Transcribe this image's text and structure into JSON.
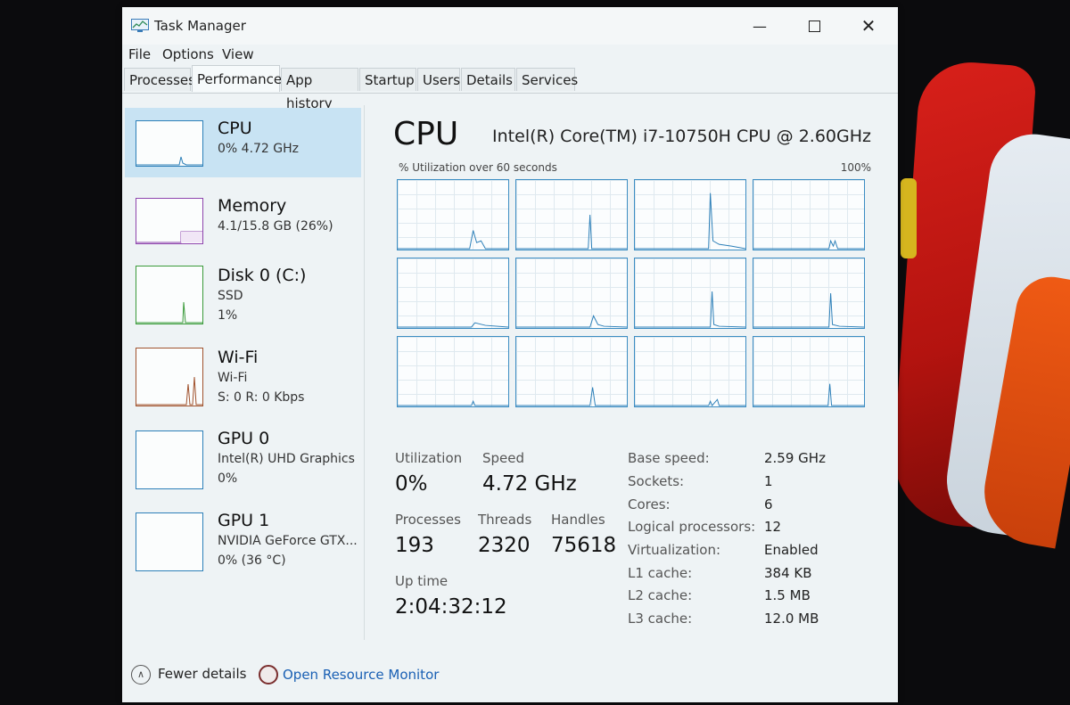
{
  "window": {
    "title": "Task Manager"
  },
  "menu": [
    "File",
    "Options",
    "View"
  ],
  "tabs": [
    {
      "label": "Processes"
    },
    {
      "label": "Performance"
    },
    {
      "label": "App history"
    },
    {
      "label": "Startup"
    },
    {
      "label": "Users"
    },
    {
      "label": "Details"
    },
    {
      "label": "Services"
    }
  ],
  "active_tab": "Performance",
  "sidebar": {
    "items": [
      {
        "name": "CPU",
        "line1": "0% 4.72 GHz",
        "line2": "",
        "color": "#2c7fb8"
      },
      {
        "name": "Memory",
        "line1": "4.1/15.8 GB (26%)",
        "line2": "",
        "color": "#8e44ad"
      },
      {
        "name": "Disk 0 (C:)",
        "line1": "SSD",
        "line2": "1%",
        "color": "#3a9a3a"
      },
      {
        "name": "Wi-Fi",
        "line1": "Wi-Fi",
        "line2": "S: 0 R: 0 Kbps",
        "color": "#a0522d"
      },
      {
        "name": "GPU 0",
        "line1": "Intel(R) UHD Graphics",
        "line2": "0%",
        "color": "#2c7fb8"
      },
      {
        "name": "GPU 1",
        "line1": "NVIDIA GeForce GTX...",
        "line2": "0% (36 °C)",
        "color": "#2c7fb8"
      }
    ]
  },
  "cpu": {
    "title": "CPU",
    "model": "Intel(R) Core(TM) i7-10750H CPU @ 2.60GHz",
    "graph_label": "% Utilization over 60 seconds",
    "graph_max": "100%",
    "stats": {
      "utilization_label": "Utilization",
      "utilization": "0%",
      "speed_label": "Speed",
      "speed": "4.72 GHz",
      "processes_label": "Processes",
      "processes": "193",
      "threads_label": "Threads",
      "threads": "2320",
      "handles_label": "Handles",
      "handles": "75618",
      "uptime_label": "Up time",
      "uptime": "2:04:32:12"
    },
    "details": [
      {
        "label": "Base speed:",
        "value": "2.59 GHz"
      },
      {
        "label": "Sockets:",
        "value": "1"
      },
      {
        "label": "Cores:",
        "value": "6"
      },
      {
        "label": "Logical processors:",
        "value": "12"
      },
      {
        "label": "Virtualization:",
        "value": "Enabled"
      },
      {
        "label": "L1 cache:",
        "value": "384 KB"
      },
      {
        "label": "L2 cache:",
        "value": "1.5 MB"
      },
      {
        "label": "L3 cache:",
        "value": "12.0 MB"
      }
    ]
  },
  "footer": {
    "fewer_details": "Fewer details",
    "resource_monitor": "Open Resource Monitor"
  }
}
